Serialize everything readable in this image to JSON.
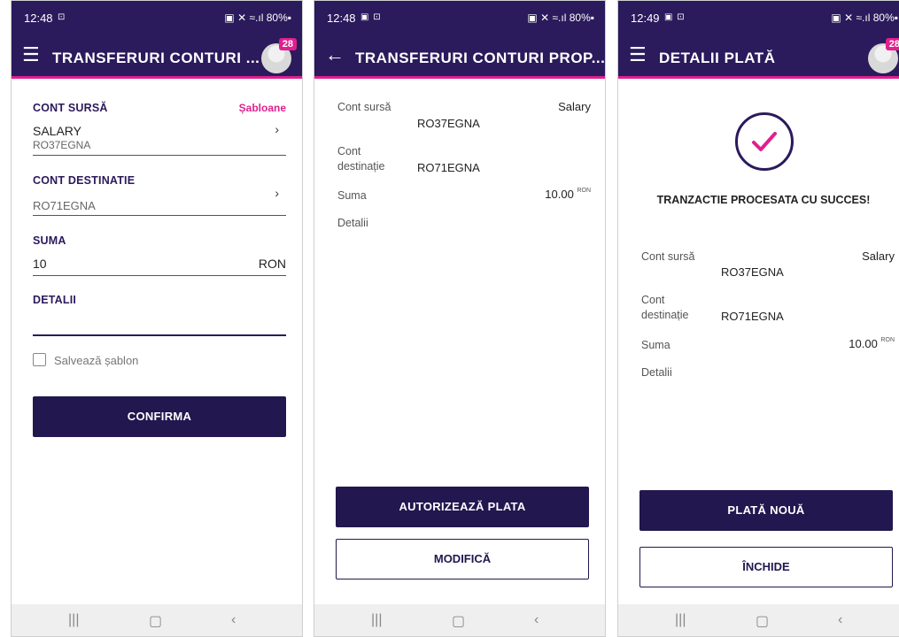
{
  "status": {
    "p1": {
      "time": "12:48",
      "icons": "⊡",
      "right": "▣ ✕ ≈.ıl 80%▪"
    },
    "p2": {
      "time": "12:48",
      "icons": "▣ ⊡",
      "right": "▣ ✕ ≈.ıl 80%▪"
    },
    "p3": {
      "time": "12:49",
      "icons": "▣ ⊡",
      "right": "▣ ✕ ≈.ıl 80%▪"
    }
  },
  "badge_count": "28",
  "screen1": {
    "title": "TRANSFERURI CONTURI ...",
    "source_label": "CONT SURSĂ",
    "templates_link": "Șabloane",
    "source_name": "SALARY",
    "source_iban": "RO37EGNA",
    "dest_label": "CONT DESTINATIE",
    "dest_iban": "RO71EGNA",
    "amount_label": "SUMA",
    "amount_value": "10",
    "currency": "RON",
    "details_label": "DETALII",
    "details_value": "",
    "save_template_label": "Salvează șablon",
    "confirm_button": "CONFIRMA"
  },
  "screen2": {
    "title": "TRANSFERURI CONTURI PROP...",
    "source_label": "Cont sursă",
    "source_name": "Salary",
    "source_iban": "RO37EGNA",
    "dest_label_1": "Cont",
    "dest_label_2": "destinație",
    "dest_iban": "RO71EGNA",
    "amount_label": "Suma",
    "amount_value": "10.00",
    "currency": "RON",
    "details_label": "Detalii",
    "authorize_button": "AUTORIZEAZĂ PLATA",
    "modify_button": "MODIFICĂ"
  },
  "screen3": {
    "title": "DETALII PLATĂ",
    "success_text": "TRANZACTIE PROCESATA CU SUCCES!",
    "source_label": "Cont sursă",
    "source_name": "Salary",
    "source_iban": "RO37EGNA",
    "dest_label_1": "Cont",
    "dest_label_2": "destinație",
    "dest_iban": "RO71EGNA",
    "amount_label": "Suma",
    "amount_value": "10.00",
    "currency": "RON",
    "details_label": "Detalii",
    "new_payment_button": "PLATĂ NOUĂ",
    "close_button": "ÎNCHIDE"
  },
  "icons": {
    "menu": "menu-icon",
    "back": "back-arrow-icon",
    "chevron": "chevron-right-icon",
    "check": "check-circle-icon",
    "nav_recent": "recent-apps-icon",
    "nav_home": "home-icon",
    "nav_back": "nav-back-icon"
  },
  "colors": {
    "brand": "#2b1a5c",
    "accent": "#e0208f"
  }
}
